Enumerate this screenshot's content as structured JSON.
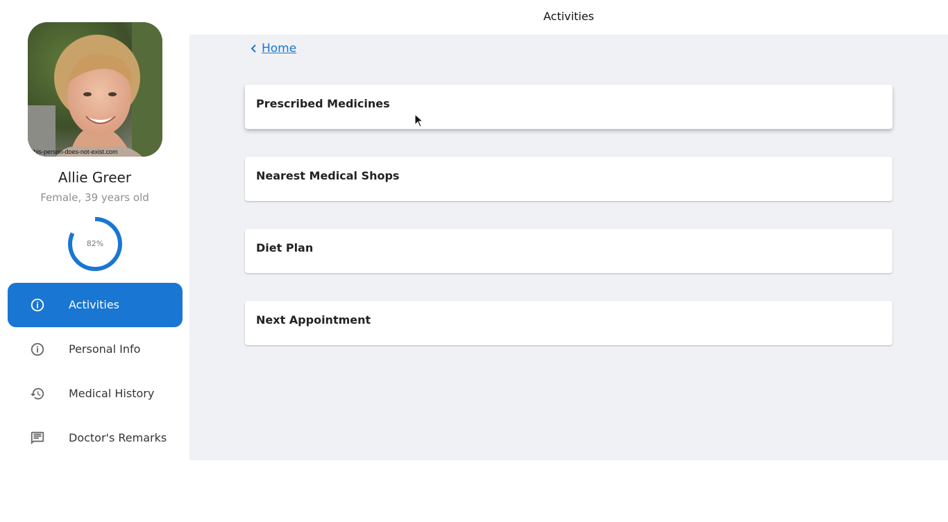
{
  "header": {
    "title": "Activities"
  },
  "profile": {
    "name": "Allie Greer",
    "meta": "Female, 39 years old",
    "photo_caption": "this-person-does-not-exist.com",
    "progress_percent": 82,
    "progress_label": "82%"
  },
  "nav": {
    "items": [
      {
        "label": "Activities",
        "icon": "info-icon",
        "active": true
      },
      {
        "label": "Personal Info",
        "icon": "info-icon",
        "active": false
      },
      {
        "label": "Medical History",
        "icon": "history-icon",
        "active": false
      },
      {
        "label": "Doctor's Remarks",
        "icon": "comment-icon",
        "active": false
      }
    ]
  },
  "breadcrumb": {
    "back_label": "Home"
  },
  "cards": [
    {
      "title": "Prescribed Medicines"
    },
    {
      "title": "Nearest Medical Shops"
    },
    {
      "title": "Diet Plan"
    },
    {
      "title": "Next Appointment"
    }
  ],
  "colors": {
    "accent": "#1976d2",
    "main_bg": "#f0f1f5",
    "progress_track": "#ffffff"
  }
}
